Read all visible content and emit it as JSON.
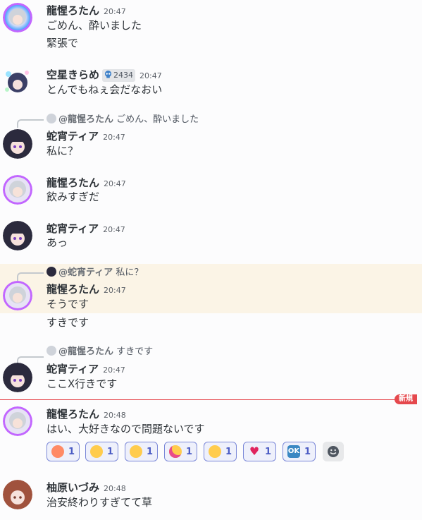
{
  "messages": [
    {
      "author": "龍惺ろたん",
      "time": "20:47",
      "lines": [
        "ごめん、酔いました",
        "緊張で"
      ]
    },
    {
      "author": "空星きらめ",
      "badge": "2434",
      "time": "20:47",
      "lines": [
        "とんでもねぇ会だなおい"
      ]
    },
    {
      "reply_author": "@龍惺ろたん",
      "reply_text": "ごめん、酔いました",
      "author": "蛇宵ティア",
      "time": "20:47",
      "lines": [
        "私に？"
      ]
    },
    {
      "author": "龍惺ろたん",
      "time": "20:47",
      "lines": [
        "飲みすぎだ"
      ]
    },
    {
      "author": "蛇宵ティア",
      "time": "20:47",
      "lines": [
        "あっ"
      ]
    },
    {
      "reply_author": "@蛇宵ティア",
      "reply_text": "私に？",
      "author": "龍惺ろたん",
      "time": "20:47",
      "lines": [
        "そうです",
        "すきです"
      ]
    },
    {
      "reply_author": "@龍惺ろたん",
      "reply_text": "すきです",
      "author": "蛇宵ティア",
      "time": "20:47",
      "lines": [
        "ここX行きです"
      ]
    },
    {
      "author": "龍惺ろたん",
      "time": "20:48",
      "lines": [
        "はい、大好きなので問題ないです"
      ]
    },
    {
      "author": "柚原いづみ",
      "time": "20:48",
      "lines": [
        "治安終わりすぎてて草"
      ]
    }
  ],
  "new_divider": "新規",
  "reactions": [
    {
      "icon": "peach-emoji-icon",
      "count": "1"
    },
    {
      "icon": "nerd-face-emoji-icon",
      "count": "1"
    },
    {
      "icon": "relieved-face-emoji-icon",
      "count": "1"
    },
    {
      "icon": "party-face-emoji-icon",
      "count": "1"
    },
    {
      "icon": "steam-face-emoji-icon",
      "count": "1"
    },
    {
      "icon": "heart-emoji-icon",
      "count": "1"
    },
    {
      "icon": "ok-button-emoji-icon",
      "label": "OK",
      "count": "1"
    }
  ],
  "colors": {
    "accent": "#5865f2",
    "new_divider": "#e5484d",
    "highlight": "#fbf4e6"
  }
}
